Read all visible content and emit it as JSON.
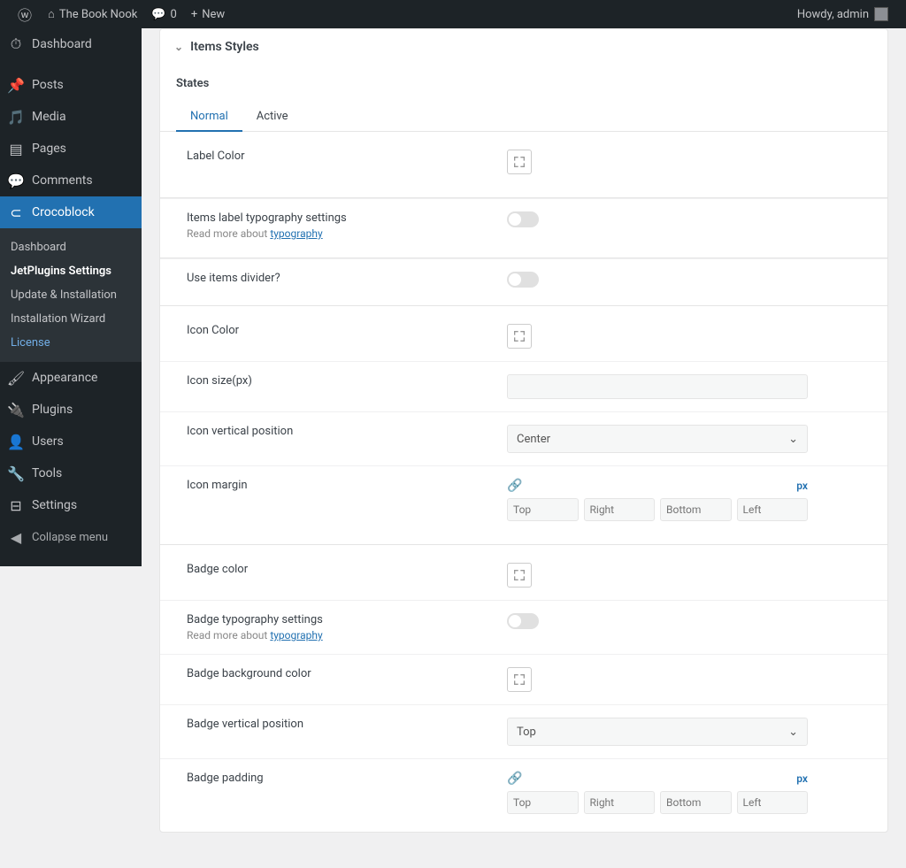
{
  "topbar": {
    "site_name": "The Book Nook",
    "comments_count": "0",
    "new_label": "New",
    "howdy": "Howdy, admin"
  },
  "sidebar": {
    "dashboard": "Dashboard",
    "posts": "Posts",
    "media": "Media",
    "pages": "Pages",
    "comments": "Comments",
    "crocoblock": "Crocoblock",
    "submenu": {
      "dashboard": "Dashboard",
      "jetplugins": "JetPlugins Settings",
      "update": "Update & Installation",
      "wizard": "Installation Wizard",
      "license": "License"
    },
    "appearance": "Appearance",
    "plugins": "Plugins",
    "users": "Users",
    "tools": "Tools",
    "settings": "Settings",
    "collapse": "Collapse menu"
  },
  "panel": {
    "title": "Items Styles",
    "states": "States",
    "tabs": {
      "normal": "Normal",
      "active": "Active"
    },
    "label_color": "Label Color",
    "typography_label": "Items label typography settings",
    "typography_sub": "Read more about ",
    "typography_link": "typography",
    "use_divider": "Use items divider?",
    "icon_color": "Icon Color",
    "icon_size": "Icon size(px)",
    "icon_vpos": "Icon vertical position",
    "icon_vpos_value": "Center",
    "icon_margin": "Icon margin",
    "badge_color": "Badge color",
    "badge_typo": "Badge typography settings",
    "badge_bg": "Badge background color",
    "badge_vpos": "Badge vertical position",
    "badge_vpos_value": "Top",
    "badge_padding": "Badge padding",
    "unit": "px",
    "dims": {
      "top": "Top",
      "right": "Right",
      "bottom": "Bottom",
      "left": "Left"
    }
  }
}
